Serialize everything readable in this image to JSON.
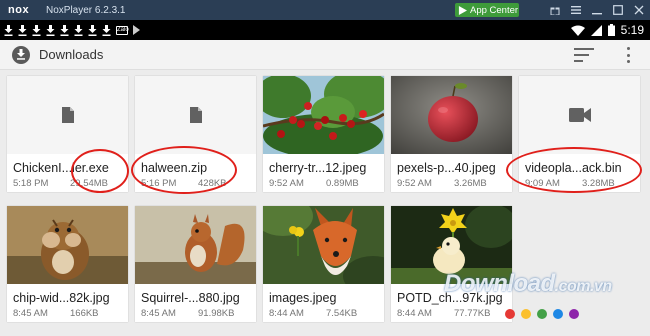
{
  "window": {
    "logo": "nox",
    "title": "NoxPlayer 6.2.3.1",
    "app_center": "App Center",
    "icons": [
      "gift-icon",
      "menu-icon",
      "minimize-icon",
      "maximize-icon",
      "close-icon"
    ]
  },
  "statusbar": {
    "time": "5:19",
    "notif_badge": "Zalo",
    "icons": [
      "wifi-icon",
      "signal-icon",
      "battery-icon"
    ]
  },
  "toolbar": {
    "title": "Downloads",
    "icons": [
      "downloads-icon",
      "sort-icon",
      "more-vert-icon"
    ]
  },
  "files": [
    {
      "name": "ChickenI...ler.exe",
      "time": "5:18 PM",
      "size": "29.54MB",
      "thumb": "file-icon"
    },
    {
      "name": "halween.zip",
      "time": "5:16 PM",
      "size": "428KB",
      "thumb": "file-icon"
    },
    {
      "name": "cherry-tr...12.jpeg",
      "time": "9:52 AM",
      "size": "0.89MB",
      "thumb": "cherry-photo"
    },
    {
      "name": "pexels-p...40.jpeg",
      "time": "9:52 AM",
      "size": "3.26MB",
      "thumb": "apple-photo"
    },
    {
      "name": "videopla...ack.bin",
      "time": "9:09 AM",
      "size": "3.28MB",
      "thumb": "video-icon"
    },
    {
      "name": "chip-wid...82k.jpg",
      "time": "8:45 AM",
      "size": "166KB",
      "thumb": "chipmunk-photo"
    },
    {
      "name": "Squirrel-...880.jpg",
      "time": "8:45 AM",
      "size": "91.98KB",
      "thumb": "squirrel-photo"
    },
    {
      "name": "images.jpeg",
      "time": "8:44 AM",
      "size": "7.54KB",
      "thumb": "fox-photo"
    },
    {
      "name": "POTD_ch...97k.jpg",
      "time": "8:44 AM",
      "size": "77.77KB",
      "thumb": "chick-photo"
    }
  ],
  "watermark": {
    "text": "Download",
    "suffix": ".com.vn"
  },
  "colors": {
    "titlebar": "#2b3e55",
    "app_center": "#3e9b3a",
    "highlight": "#e0201b"
  }
}
